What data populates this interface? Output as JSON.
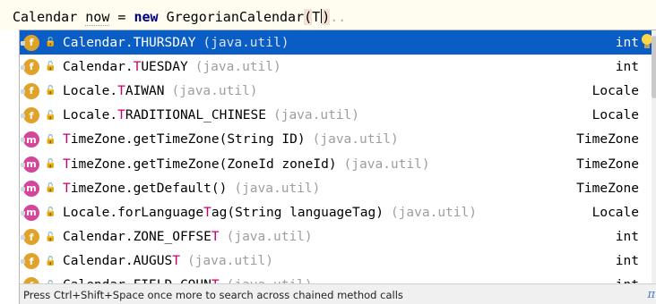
{
  "editor": {
    "tokens": {
      "type": "Calendar",
      "var": "now",
      "eq": "=",
      "kw_new": "new",
      "ctor": "GregorianCalendar",
      "open_paren": "(",
      "typed": "T",
      "close_paren": ")",
      "dots": ".."
    }
  },
  "completion": {
    "items": [
      {
        "kind": "f",
        "pre": "Calendar.",
        "match": "T",
        "post": "HURSDAY",
        "pkg": "(java.util)",
        "type": "int",
        "selected": true
      },
      {
        "kind": "f",
        "pre": "Calendar.",
        "match": "T",
        "post": "UESDAY",
        "pkg": "(java.util)",
        "type": "int"
      },
      {
        "kind": "f",
        "pre": "Locale.",
        "match": "T",
        "post": "AIWAN",
        "pkg": "(java.util)",
        "type": "Locale"
      },
      {
        "kind": "f",
        "pre": "Locale.",
        "match": "T",
        "post": "RADITIONAL_CHINESE",
        "pkg": "(java.util)",
        "type": "Locale"
      },
      {
        "kind": "m",
        "pre": "",
        "match": "T",
        "post": "imeZone.getTimeZone(String ID)",
        "pkg": "(java.util)",
        "type": "TimeZone"
      },
      {
        "kind": "m",
        "pre": "",
        "match": "T",
        "post": "imeZone.getTimeZone(ZoneId zoneId)",
        "pkg": "(java.util)",
        "type": "TimeZone"
      },
      {
        "kind": "m",
        "pre": "",
        "match": "T",
        "post": "imeZone.getDefault()",
        "pkg": "(java.util)",
        "type": "TimeZone"
      },
      {
        "kind": "m",
        "pre": "Locale.forLanguage",
        "match": "T",
        "post": "ag(String languageTag)",
        "pkg": "(java.util)",
        "type": "Locale"
      },
      {
        "kind": "f",
        "pre": "Calendar.ZONE_OFFSE",
        "match": "T",
        "post": "",
        "pkg": "(java.util)",
        "type": "int"
      },
      {
        "kind": "f",
        "pre": "Calendar.AUGUS",
        "match": "T",
        "post": "",
        "pkg": "(java.util)",
        "type": "int"
      },
      {
        "kind": "f",
        "pre": "Calendar.FIELD_COUN",
        "match": "T",
        "post": "",
        "pkg": "(java.util)",
        "type": "int"
      }
    ],
    "footer_hint": "Press Ctrl+Shift+Space once more to search across chained method calls",
    "footer_symbol": "π"
  },
  "colors": {
    "selected_bg": "#0a5dc4",
    "match": "#c8006e",
    "field_icon": "#e1a22a",
    "method_icon": "#d4469a"
  },
  "icons": {
    "field": "field-icon",
    "method": "method-icon",
    "visibility": "public-lock-icon",
    "intention": "lightbulb-icon"
  }
}
